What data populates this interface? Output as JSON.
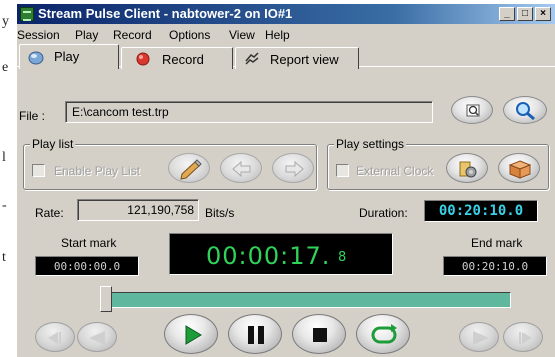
{
  "left_strip": [
    "y",
    "e",
    "l",
    "-",
    "t"
  ],
  "window": {
    "title": "Stream Pulse Client - nabtower-2 on IO#1",
    "controls": {
      "minimize": "_",
      "maximize": "□",
      "close": "×"
    }
  },
  "menu": [
    "Session",
    "Play",
    "Record",
    "Options",
    "View",
    "Help"
  ],
  "tabs": [
    {
      "label": "Play",
      "active": true
    },
    {
      "label": "Record",
      "active": false
    },
    {
      "label": "Report view",
      "active": false
    }
  ],
  "file": {
    "label": "File :",
    "value": "E:\\cancom test.trp"
  },
  "play_list": {
    "title": "Play list",
    "enable_label": "Enable Play List"
  },
  "play_settings": {
    "title": "Play settings",
    "external_clock_label": "External Clock"
  },
  "rate": {
    "label": "Rate:",
    "value": "121,190,758",
    "unit": "Bits/s"
  },
  "duration": {
    "label": "Duration:",
    "value": "00:20:10.0"
  },
  "start_mark": {
    "label": "Start mark",
    "value": "00:00:00.0"
  },
  "end_mark": {
    "label": "End mark",
    "value": "00:20:10.0"
  },
  "position": {
    "main": "00:00:17.",
    "fraction": "8"
  },
  "slider": {
    "position_fraction": 0.0
  },
  "colors": {
    "lcd_green": "#2fd35a",
    "lcd_cyan": "#3ad1e8",
    "track": "#5fb89e",
    "title_start": "#0a246a",
    "title_end": "#a6caf0"
  }
}
